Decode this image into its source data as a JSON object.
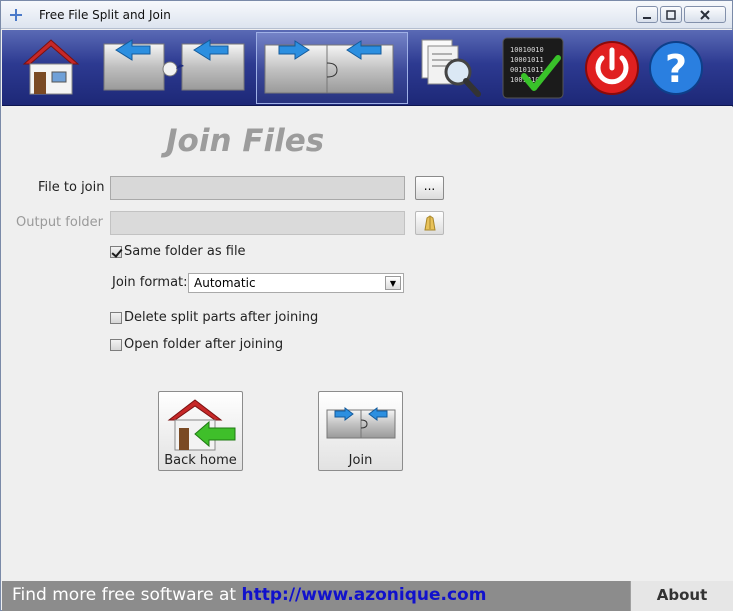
{
  "window": {
    "title": "Free File Split and Join"
  },
  "toolbar": {
    "items": [
      {
        "icon": "home-icon"
      },
      {
        "icon": "split-icon"
      },
      {
        "icon": "join-icon"
      },
      {
        "icon": "search-files-icon"
      },
      {
        "icon": "verify-checksum-icon"
      },
      {
        "icon": "power-icon"
      },
      {
        "icon": "help-icon"
      }
    ],
    "checksum_digits": [
      "10010010",
      "10001011",
      "00101011",
      "10010100"
    ]
  },
  "main": {
    "heading": "Join Files",
    "file_to_join": {
      "label": "File to join",
      "value": "",
      "browse_label": "..."
    },
    "output_folder": {
      "label": "Output folder",
      "value": ""
    },
    "same_folder": {
      "label": "Same folder as  file",
      "checked": true
    },
    "join_format": {
      "label": "Join format:",
      "selected": "Automatic"
    },
    "delete_parts": {
      "label": "Delete split parts after joining",
      "checked": false
    },
    "open_folder": {
      "label": "Open folder after joining",
      "checked": false
    },
    "back_home_label": "Back home",
    "join_label": "Join"
  },
  "footer": {
    "promo_text": "Find more free software at",
    "link_text": "http://www.azonique.com",
    "about_label": "About"
  }
}
